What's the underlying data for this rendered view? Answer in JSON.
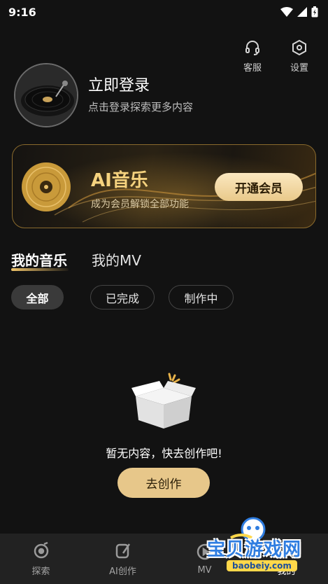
{
  "status_bar": {
    "time": "9:16"
  },
  "top_actions": {
    "service_label": "客服",
    "settings_label": "设置"
  },
  "profile": {
    "login_title": "立即登录",
    "login_subtitle": "点击登录探索更多内容"
  },
  "vip_banner": {
    "title": "AI音乐",
    "subtitle": "成为会员解锁全部功能",
    "button_label": "开通会员"
  },
  "tabs": [
    {
      "label": "我的音乐",
      "active": true
    },
    {
      "label": "我的MV",
      "active": false
    }
  ],
  "filters": [
    {
      "label": "全部",
      "active": true
    },
    {
      "label": "已完成",
      "active": false
    },
    {
      "label": "制作中",
      "active": false
    }
  ],
  "empty_state": {
    "message": "暂无内容，快去创作吧!",
    "button_label": "去创作"
  },
  "bottom_nav": [
    {
      "label": "探索",
      "icon": "explore-icon"
    },
    {
      "label": "AI创作",
      "icon": "ai-create-icon"
    },
    {
      "label": "MV",
      "icon": "mv-icon"
    },
    {
      "label": "我的",
      "icon": "profile-icon"
    }
  ],
  "watermark": {
    "text": "宝贝游戏网",
    "url": "baobeiy.com"
  },
  "colors": {
    "background": "#121212",
    "gold": "#e7c78a",
    "nav_bg": "#222222"
  }
}
